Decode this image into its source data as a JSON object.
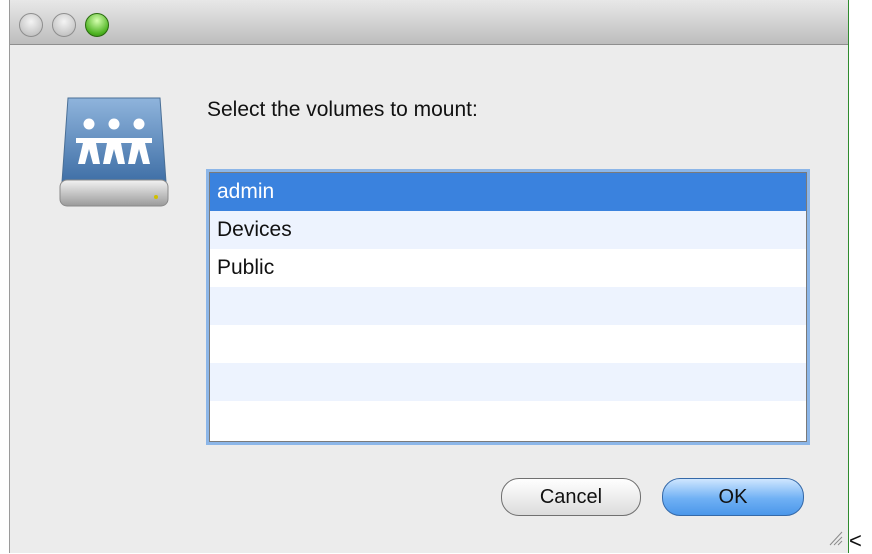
{
  "dialog": {
    "prompt": "Select the volumes to mount:",
    "volumes": [
      "admin",
      "Devices",
      "Public"
    ],
    "selected_volume": "admin",
    "cancel_label": "Cancel",
    "ok_label": "OK"
  },
  "trailing_text": "<",
  "colors": {
    "selection": "#3a82de",
    "focus_ring": "#8cb6e8",
    "default_button": "#4b97ea",
    "zoom_button": "#4db321"
  },
  "icons": {
    "server": "shared-server-icon"
  }
}
